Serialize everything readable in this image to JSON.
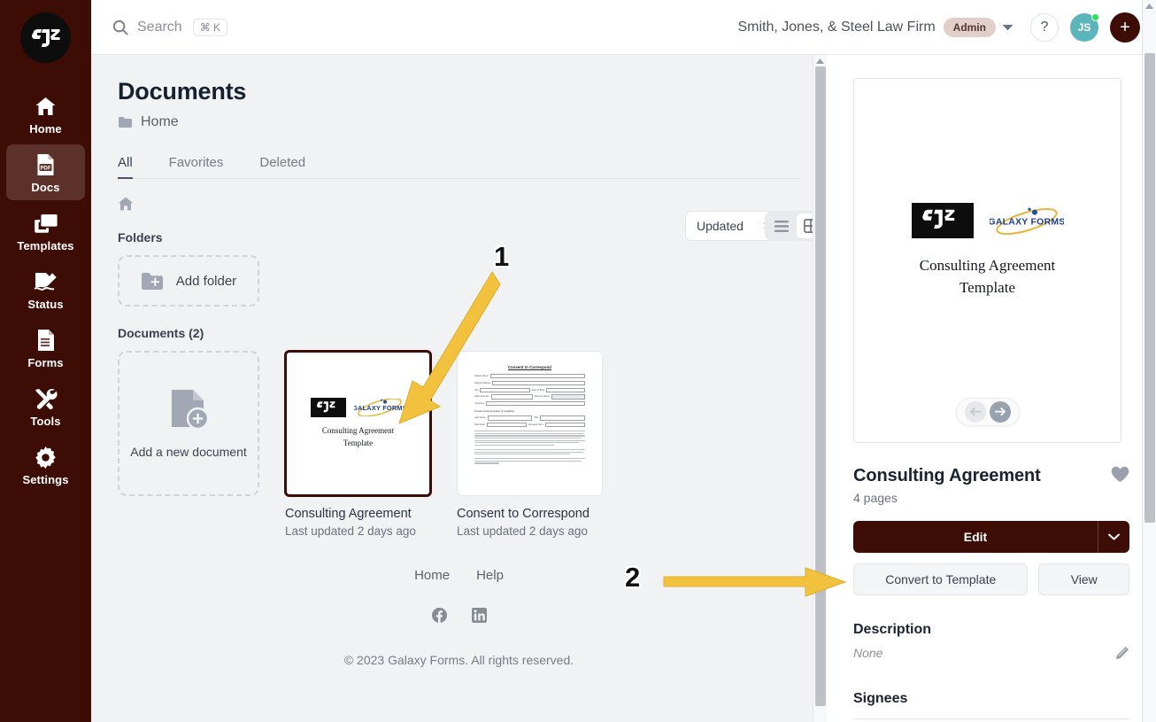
{
  "sidebar": {
    "logo_text": "SJS",
    "items": [
      {
        "label": "Home",
        "icon": "home-icon",
        "active": false
      },
      {
        "label": "Docs",
        "icon": "pdf-icon",
        "active": true
      },
      {
        "label": "Templates",
        "icon": "templates-icon",
        "active": false
      },
      {
        "label": "Status",
        "icon": "signature-icon",
        "active": false
      },
      {
        "label": "Forms",
        "icon": "forms-icon",
        "active": false
      },
      {
        "label": "Tools",
        "icon": "tools-icon",
        "active": false
      },
      {
        "label": "Settings",
        "icon": "gear-icon",
        "active": false
      }
    ]
  },
  "header": {
    "search_label": "Search",
    "search_shortcut": "⌘ K",
    "search_icon": "search-icon",
    "org_name": "Smith, Jones, & Steel Law Firm",
    "role_badge": "Admin",
    "help_label": "?",
    "avatar_initials": "JS",
    "add_label": "+"
  },
  "main": {
    "page_title": "Documents",
    "breadcrumb_label": "Home",
    "breadcrumb_icon": "folder-icon",
    "home_icon": "home-icon",
    "tabs": [
      {
        "label": "All",
        "active": true
      },
      {
        "label": "Favorites",
        "active": false
      },
      {
        "label": "Deleted",
        "active": false
      }
    ],
    "sort_value": "Updated",
    "view_modes": [
      {
        "name": "list-view",
        "active": false
      },
      {
        "name": "grid-view",
        "active": true
      }
    ],
    "folders_label": "Folders",
    "add_folder_label": "Add folder",
    "documents_label": "Documents (2)",
    "add_document_label": "Add a new document",
    "documents": [
      {
        "name": "Consulting Agreement",
        "meta": "Last updated 2 days ago",
        "selected": true,
        "thumb_type": "cover",
        "thumb_title": "Consulting Agreement\nTemplate"
      },
      {
        "name": "Consent to Correspond",
        "meta": "Last updated 2 days ago",
        "selected": false,
        "thumb_type": "form",
        "thumb_title": "Consent to Correspond"
      }
    ]
  },
  "footer": {
    "links": [
      "Home",
      "Help"
    ],
    "social": [
      "facebook-icon",
      "linkedin-icon"
    ],
    "copyright": "© 2023 Galaxy Forms. All rights reserved."
  },
  "preview": {
    "logo_left": "SJS",
    "logo_right": "GALAXY FORMS",
    "doc_title_line1": "Consulting Agreement",
    "doc_title_line2": "Template",
    "prev_label": "previous-page",
    "next_label": "next-page"
  },
  "details": {
    "title": "Consulting Agreement",
    "pages": "4 pages",
    "favorite_icon": "heart-icon",
    "edit_label": "Edit",
    "convert_label": "Convert to Template",
    "view_label": "View",
    "description_heading": "Description",
    "description_value": "None",
    "edit_description_icon": "pencil-icon",
    "signees_heading": "Signees"
  },
  "annotations": [
    {
      "number": "1",
      "target": "consulting-agreement-card"
    },
    {
      "number": "2",
      "target": "convert-to-template-button"
    }
  ],
  "colors": {
    "sidebar_bg": "#3d0d05",
    "app_bg": "#f1f2f4",
    "accent": "#3d0d05",
    "badge_bg": "#e3cfc9",
    "avatar_bg": "#5bb5ba",
    "status_dot": "#2ee05f",
    "annotation_arrow": "#f2c23e"
  }
}
